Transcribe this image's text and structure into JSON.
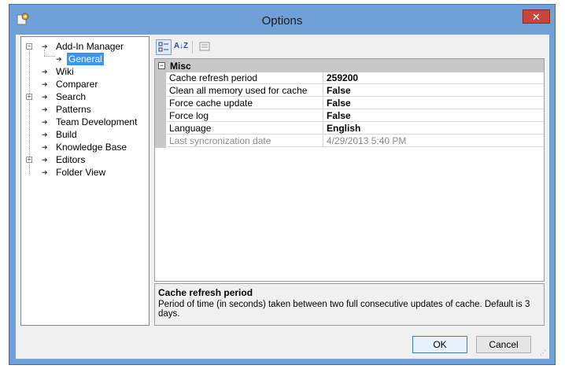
{
  "window": {
    "title": "Options",
    "close_glyph": "✕"
  },
  "tree": {
    "items": [
      {
        "label": "Add-In Manager",
        "expander": "minus"
      },
      {
        "label": "General",
        "selected": true,
        "child": true
      },
      {
        "label": "Wiki"
      },
      {
        "label": "Comparer"
      },
      {
        "label": "Search",
        "expander": "plus"
      },
      {
        "label": "Patterns"
      },
      {
        "label": "Team Development"
      },
      {
        "label": "Build"
      },
      {
        "label": "Knowledge Base"
      },
      {
        "label": "Editors",
        "expander": "plus"
      },
      {
        "label": "Folder View"
      }
    ]
  },
  "toolbar": {
    "categorized_icon": "categorized-icon",
    "alphabetical_label": "A↓Z",
    "property_pages_icon": "property-pages-icon"
  },
  "property_grid": {
    "category": "Misc",
    "rows": [
      {
        "name": "Cache refresh period",
        "value": "259200"
      },
      {
        "name": "Clean all memory used for cache",
        "value": "False"
      },
      {
        "name": "Force cache update",
        "value": "False"
      },
      {
        "name": "Force log",
        "value": "False"
      },
      {
        "name": "Language",
        "value": "English"
      },
      {
        "name": "Last syncronization date",
        "value": "4/29/2013 5:40 PM",
        "readonly": true
      }
    ]
  },
  "description": {
    "title": "Cache refresh period",
    "text": "Period of time (in seconds) taken between two full consecutive updates of cache. Default is 3 days."
  },
  "buttons": {
    "ok": "OK",
    "cancel": "Cancel"
  }
}
